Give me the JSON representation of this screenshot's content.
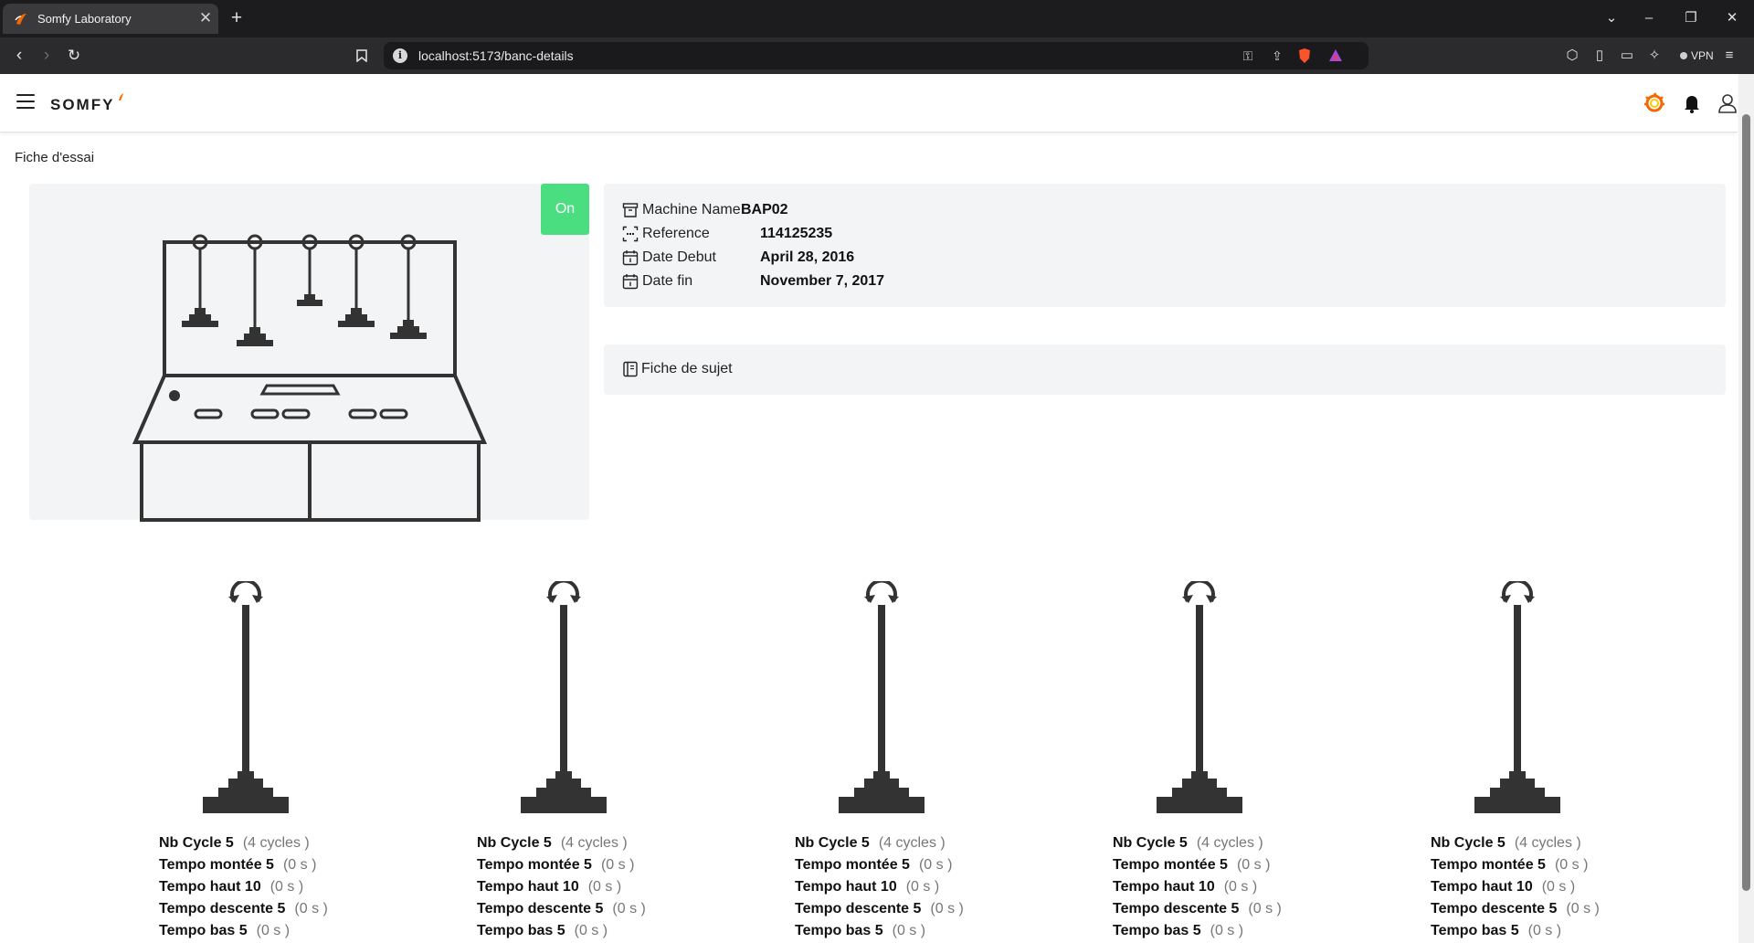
{
  "browser": {
    "tab_title": "Somfy Laboratory",
    "url": "localhost:5173/banc-details",
    "vpn_label": "VPN"
  },
  "app": {
    "brand": "SOMFY",
    "icons": [
      "menu-icon",
      "grafana-icon",
      "bell-icon",
      "user-icon"
    ],
    "accent_color": "#f46800"
  },
  "page": {
    "title": "Fiche d'essai"
  },
  "machine": {
    "status": "On",
    "status_color": "#4ade80",
    "fields": [
      {
        "label": "Machine Name",
        "value": "BAP02"
      },
      {
        "label": "Reference",
        "value": "114125235"
      },
      {
        "label": "Date Debut",
        "value": "April 28, 2016"
      },
      {
        "label": "Date fin",
        "value": "November 7, 2017"
      }
    ],
    "subject_link": "Fiche de sujet"
  },
  "stations": [
    {
      "stats": [
        {
          "key": "Nb Cycle 5",
          "value": "(4 cycles )"
        },
        {
          "key": "Tempo montée 5",
          "value": "(0 s )"
        },
        {
          "key": "Tempo haut 10",
          "value": "(0 s )"
        },
        {
          "key": "Tempo descente 5",
          "value": "(0 s )"
        },
        {
          "key": "Tempo bas 5",
          "value": "(0 s )"
        }
      ]
    },
    {
      "stats": [
        {
          "key": "Nb Cycle 5",
          "value": "(4 cycles )"
        },
        {
          "key": "Tempo montée 5",
          "value": "(0 s )"
        },
        {
          "key": "Tempo haut 10",
          "value": "(0 s )"
        },
        {
          "key": "Tempo descente 5",
          "value": "(0 s )"
        },
        {
          "key": "Tempo bas 5",
          "value": "(0 s )"
        }
      ]
    },
    {
      "stats": [
        {
          "key": "Nb Cycle 5",
          "value": "(4 cycles )"
        },
        {
          "key": "Tempo montée 5",
          "value": "(0 s )"
        },
        {
          "key": "Tempo haut 10",
          "value": "(0 s )"
        },
        {
          "key": "Tempo descente 5",
          "value": "(0 s )"
        },
        {
          "key": "Tempo bas 5",
          "value": "(0 s )"
        }
      ]
    },
    {
      "stats": [
        {
          "key": "Nb Cycle 5",
          "value": "(4 cycles )"
        },
        {
          "key": "Tempo montée 5",
          "value": "(0 s )"
        },
        {
          "key": "Tempo haut 10",
          "value": "(0 s )"
        },
        {
          "key": "Tempo descente 5",
          "value": "(0 s )"
        },
        {
          "key": "Tempo bas 5",
          "value": "(0 s )"
        }
      ]
    },
    {
      "stats": [
        {
          "key": "Nb Cycle 5",
          "value": "(4 cycles )"
        },
        {
          "key": "Tempo montée 5",
          "value": "(0 s )"
        },
        {
          "key": "Tempo haut 10",
          "value": "(0 s )"
        },
        {
          "key": "Tempo descente 5",
          "value": "(0 s )"
        },
        {
          "key": "Tempo bas 5",
          "value": "(0 s )"
        }
      ]
    }
  ]
}
